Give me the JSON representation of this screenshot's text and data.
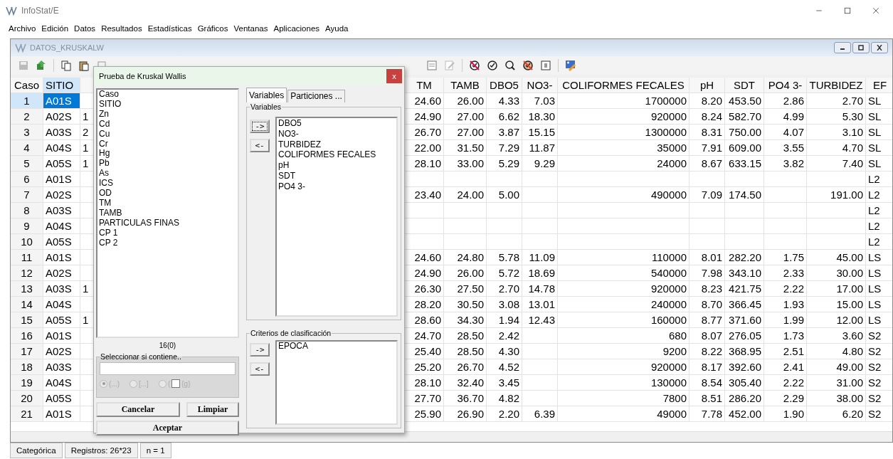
{
  "window": {
    "title": "InfoStat/E"
  },
  "menu": [
    "Archivo",
    "Edición",
    "Datos",
    "Resultados",
    "Estadísticas",
    "Gráficos",
    "Ventanas",
    "Aplicaciones",
    "Ayuda"
  ],
  "document": {
    "title": "DATOS_KRUSKALW"
  },
  "table": {
    "columns": [
      "Caso",
      "SITIO",
      "TM",
      "TAMB",
      "DBO5",
      "NO3-",
      "COLIFORMES FECALES",
      "pH",
      "SDT",
      "PO4 3-",
      "TURBIDEZ",
      "EF"
    ],
    "rows": [
      {
        "selected": true,
        "values": {
          "caso": "1",
          "sitio": "A01S",
          "tm": "24.60",
          "tamb": "26.00",
          "dbo5": "4.33",
          "no3": "7.03",
          "coliformes": "1700000",
          "ph": "8.20",
          "sdt": "453.50",
          "po4": "2.86",
          "turbidez": "2.70",
          "ef": "SL"
        }
      },
      {
        "selected": false,
        "values": {
          "caso": "2",
          "sitio": "A02S",
          "column_3": "1",
          "tm": "24.90",
          "tamb": "27.00",
          "dbo5": "6.62",
          "no3": "18.30",
          "coliformes": "920000",
          "ph": "8.24",
          "sdt": "582.70",
          "po4": "4.99",
          "turbidez": "5.30",
          "ef": "SL"
        }
      },
      {
        "selected": false,
        "values": {
          "caso": "3",
          "sitio": "A03S",
          "column_3": "2",
          "tm": "26.70",
          "tamb": "27.00",
          "dbo5": "3.87",
          "no3": "15.15",
          "coliformes": "1300000",
          "ph": "8.31",
          "sdt": "750.00",
          "po4": "4.07",
          "turbidez": "3.10",
          "ef": "SL"
        }
      },
      {
        "selected": false,
        "values": {
          "caso": "4",
          "sitio": "A04S",
          "column_3": "1",
          "tm": "22.00",
          "tamb": "31.50",
          "dbo5": "7.29",
          "no3": "11.87",
          "coliformes": "35000",
          "ph": "7.91",
          "sdt": "609.00",
          "po4": "3.55",
          "turbidez": "4.70",
          "ef": "SL"
        }
      },
      {
        "selected": false,
        "values": {
          "caso": "5",
          "sitio": "A05S",
          "column_3": "1",
          "tm": "28.10",
          "tamb": "33.00",
          "dbo5": "5.29",
          "no3": "9.29",
          "coliformes": "24000",
          "ph": "8.67",
          "sdt": "633.15",
          "po4": "3.82",
          "turbidez": "7.40",
          "ef": "SL"
        }
      },
      {
        "selected": false,
        "values": {
          "caso": "6",
          "sitio": "A01S",
          "ef": "L2"
        }
      },
      {
        "selected": false,
        "values": {
          "caso": "7",
          "sitio": "A02S",
          "tm": "23.40",
          "tamb": "24.00",
          "dbo5": "5.00",
          "coliformes": "490000",
          "ph": "7.09",
          "sdt": "174.50",
          "turbidez": "191.00",
          "ef": "L2"
        }
      },
      {
        "selected": false,
        "values": {
          "caso": "8",
          "sitio": "A03S",
          "ef": "L2"
        }
      },
      {
        "selected": false,
        "values": {
          "caso": "9",
          "sitio": "A04S",
          "ef": "L2"
        }
      },
      {
        "selected": false,
        "values": {
          "caso": "10",
          "sitio": "A05S",
          "ef": "L2"
        }
      },
      {
        "selected": false,
        "values": {
          "caso": "11",
          "sitio": "A01S",
          "tm": "24.60",
          "tamb": "24.80",
          "dbo5": "5.78",
          "no3": "11.09",
          "coliformes": "110000",
          "ph": "8.01",
          "sdt": "282.20",
          "po4": "1.75",
          "turbidez": "45.00",
          "ef": "LS"
        }
      },
      {
        "selected": false,
        "values": {
          "caso": "12",
          "sitio": "A02S",
          "tm": "24.90",
          "tamb": "26.00",
          "dbo5": "5.72",
          "no3": "18.69",
          "coliformes": "540000",
          "ph": "7.98",
          "sdt": "343.10",
          "po4": "2.33",
          "turbidez": "30.00",
          "ef": "LS"
        }
      },
      {
        "selected": false,
        "values": {
          "caso": "13",
          "sitio": "A03S",
          "column_3": "1",
          "tm": "26.30",
          "tamb": "27.50",
          "dbo5": "2.70",
          "no3": "14.78",
          "coliformes": "920000",
          "ph": "8.23",
          "sdt": "421.75",
          "po4": "2.22",
          "turbidez": "17.00",
          "ef": "LS"
        }
      },
      {
        "selected": false,
        "values": {
          "caso": "14",
          "sitio": "A04S",
          "tm": "28.20",
          "tamb": "30.50",
          "dbo5": "3.08",
          "no3": "13.01",
          "coliformes": "240000",
          "ph": "8.70",
          "sdt": "366.45",
          "po4": "1.93",
          "turbidez": "15.00",
          "ef": "LS"
        }
      },
      {
        "selected": false,
        "values": {
          "caso": "15",
          "sitio": "A05S",
          "column_3": "1",
          "tm": "28.60",
          "tamb": "34.30",
          "dbo5": "1.94",
          "no3": "12.43",
          "coliformes": "160000",
          "ph": "8.77",
          "sdt": "371.60",
          "po4": "1.99",
          "turbidez": "12.00",
          "ef": "LS"
        }
      },
      {
        "selected": false,
        "values": {
          "caso": "16",
          "sitio": "A01S",
          "tm": "24.70",
          "tamb": "28.50",
          "dbo5": "2.42",
          "coliformes": "680",
          "ph": "8.07",
          "sdt": "276.05",
          "po4": "1.73",
          "turbidez": "3.60",
          "ef": "S2"
        }
      },
      {
        "selected": false,
        "values": {
          "caso": "17",
          "sitio": "A02S",
          "tm": "25.40",
          "tamb": "28.50",
          "dbo5": "4.30",
          "coliformes": "9200",
          "ph": "8.22",
          "sdt": "368.95",
          "po4": "2.51",
          "turbidez": "4.80",
          "ef": "S2"
        }
      },
      {
        "selected": false,
        "values": {
          "caso": "18",
          "sitio": "A03S",
          "tm": "25.20",
          "tamb": "26.70",
          "dbo5": "4.52",
          "coliformes": "920000",
          "ph": "8.17",
          "sdt": "392.60",
          "po4": "2.41",
          "turbidez": "49.00",
          "ef": "S2"
        }
      },
      {
        "selected": false,
        "values": {
          "caso": "19",
          "sitio": "A04S",
          "tm": "28.10",
          "tamb": "32.40",
          "dbo5": "3.45",
          "coliformes": "130000",
          "ph": "8.54",
          "sdt": "305.40",
          "po4": "2.22",
          "turbidez": "31.00",
          "ef": "S2"
        }
      },
      {
        "selected": false,
        "values": {
          "caso": "20",
          "sitio": "A05S",
          "tm": "27.70",
          "tamb": "36.70",
          "dbo5": "4.82",
          "coliformes": "7800",
          "ph": "8.51",
          "sdt": "286.20",
          "po4": "2.29",
          "turbidez": "38.00",
          "ef": "S2"
        }
      },
      {
        "selected": false,
        "values": {
          "caso": "21",
          "sitio": "A01S",
          "tm": "25.90",
          "tamb": "26.90",
          "dbo5": "2.20",
          "no3": "6.39",
          "coliformes": "49000",
          "ph": "7.78",
          "sdt": "452.00",
          "po4": "1.90",
          "turbidez": "6.20",
          "ef": "S2"
        }
      }
    ]
  },
  "dialog": {
    "title": "Prueba de Kruskal Wallis",
    "close": "x",
    "source_list": [
      "Caso",
      "SITIO",
      "Zn",
      "Cd",
      "Cu",
      "Cr",
      "Hg",
      "Pb",
      "As",
      "ICS",
      "OD",
      "TM",
      "TAMB",
      "PARTICULAS FINAS",
      "CP 1",
      "CP 2"
    ],
    "count": "16(0)",
    "filter": {
      "legend": "Seleccionar si contiene..",
      "options": [
        {
          "label": "(...)",
          "selected": true,
          "disabled": true
        },
        {
          "label": "[...]",
          "selected": false,
          "disabled": true
        },
        {
          "label": "(",
          "selected": false,
          "disabled": true,
          "checkbox": {
            "checked": false,
            "label": "{g}"
          }
        }
      ]
    },
    "buttons": {
      "cancel": "Cancelar",
      "clear": "Limpiar",
      "accept": "Aceptar"
    },
    "tabs": [
      {
        "label": "Variables",
        "selected": true
      },
      {
        "label": "Particiones ...",
        "selected": false
      }
    ],
    "variables": {
      "legend": "Variables",
      "add": "->",
      "remove": "<-",
      "items": [
        "DBO5",
        "NO3-",
        "TURBIDEZ",
        "COLIFORMES FECALES",
        "pH",
        "SDT",
        "PO4 3-"
      ]
    },
    "criteria": {
      "legend": "Criterios de clasificación",
      "add": "->",
      "remove": "<-",
      "items": [
        "EPOCA"
      ]
    }
  },
  "status_bar": [
    "Categórica",
    "Registros: 26*23",
    "n = 1"
  ]
}
